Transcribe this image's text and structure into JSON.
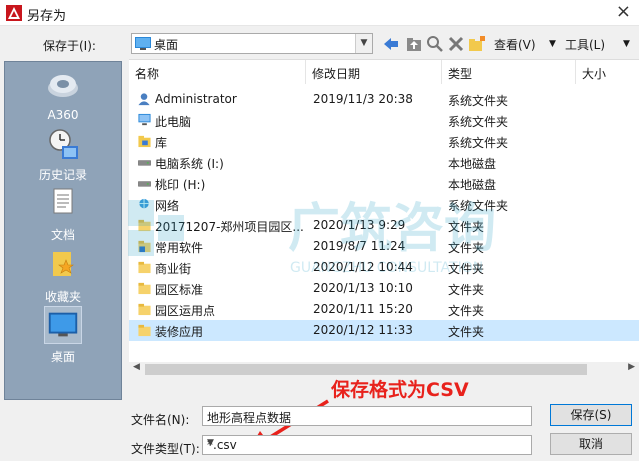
{
  "window": {
    "title": "另存为"
  },
  "toolbar": {
    "save_in_label": "保存于(I):",
    "save_in_value": "桌面",
    "view_label": "查看(V)",
    "tools_label": "工具(L)"
  },
  "places": [
    {
      "label": "A360"
    },
    {
      "label": "历史记录"
    },
    {
      "label": "文档"
    },
    {
      "label": "收藏夹"
    },
    {
      "label": "桌面"
    }
  ],
  "columns": {
    "name": "名称",
    "modified": "修改日期",
    "type": "类型",
    "size": "大小"
  },
  "files": [
    {
      "icon": "user-folder-icon",
      "name": "Administrator",
      "date": "2019/11/3 20:38",
      "type": "系统文件夹"
    },
    {
      "icon": "computer-icon",
      "name": "此电脑",
      "date": "",
      "type": "系统文件夹"
    },
    {
      "icon": "library-icon",
      "name": "库",
      "date": "",
      "type": "系统文件夹"
    },
    {
      "icon": "drive-icon",
      "name": "电脑系统 (I:)",
      "date": "",
      "type": "本地磁盘"
    },
    {
      "icon": "drive-icon",
      "name": "桃印 (H:)",
      "date": "",
      "type": "本地磁盘"
    },
    {
      "icon": "network-icon",
      "name": "网络",
      "date": "",
      "type": "系统文件夹"
    },
    {
      "icon": "folder-icon",
      "name": "20171207-郑州项目园区...",
      "date": "2020/1/13 9:29",
      "type": "文件夹"
    },
    {
      "icon": "folder-shortcut-icon",
      "name": "常用软件",
      "date": "2019/8/7 11:24",
      "type": "文件夹"
    },
    {
      "icon": "folder-icon",
      "name": "商业街",
      "date": "2020/1/12 10:44",
      "type": "文件夹"
    },
    {
      "icon": "folder-icon",
      "name": "园区标准",
      "date": "2020/1/13 10:10",
      "type": "文件夹"
    },
    {
      "icon": "folder-icon",
      "name": "园区运用点",
      "date": "2020/1/11 15:20",
      "type": "文件夹"
    },
    {
      "icon": "folder-icon",
      "name": "装修应用",
      "date": "2020/1/12 11:33",
      "type": "文件夹"
    }
  ],
  "watermark": {
    "main": "广筑咨询",
    "sub": "GUANGZHU CONSULTATION"
  },
  "annotation": {
    "text": "保存格式为CSV",
    "color": "#e8221c"
  },
  "file_name": {
    "label": "文件名(N):",
    "value": "地形高程点数据"
  },
  "file_type": {
    "label": "文件类型(T):",
    "value": "*.csv"
  },
  "buttons": {
    "save": "保存(S)",
    "cancel": "取消"
  },
  "colors": {
    "places_bg": "#8fa3b8",
    "selection": "#cce8ff",
    "folder": "#f6d26b"
  }
}
